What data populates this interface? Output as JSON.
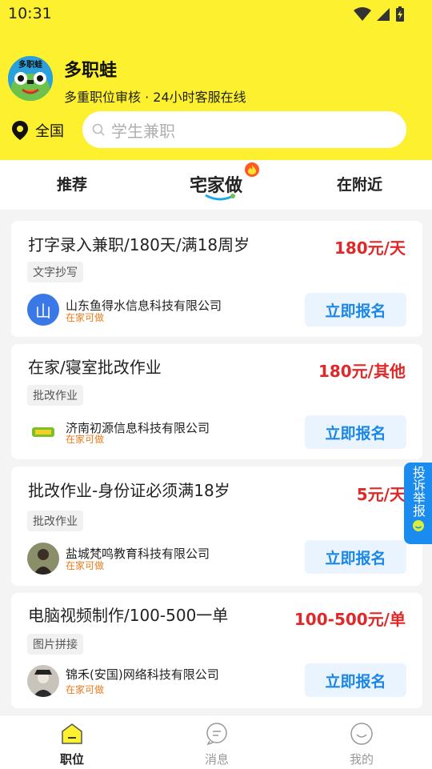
{
  "status": {
    "time": "10:31"
  },
  "header": {
    "logo_text": "多职蛙",
    "app_name": "多职蛙",
    "subtitle": "多重职位审核 · 24小时客服在线",
    "location": "全国",
    "search_placeholder": "学生兼职"
  },
  "tabs": [
    {
      "label": "推荐"
    },
    {
      "label": "宅家做"
    },
    {
      "label": "在附近"
    }
  ],
  "jobs": [
    {
      "title": "打字录入兼职/180天/满18周岁",
      "price": "180元/天",
      "tag": "文字抄写",
      "company": "山东鱼得水信息科技有限公司",
      "location": "在家可做",
      "avatar_text": "山",
      "apply": "立即报名"
    },
    {
      "title": "在家/寝室批改作业",
      "price": "180元/其他",
      "tag": "批改作业",
      "company": "济南初源信息科技有限公司",
      "location": "在家可做",
      "avatar_text": "",
      "apply": "立即报名"
    },
    {
      "title": "批改作业-身份证必须满18岁",
      "price": "5元/天",
      "tag": "批改作业",
      "company": "盐城梵鸣教育科技有限公司",
      "location": "在家可做",
      "avatar_text": "",
      "apply": "立即报名"
    },
    {
      "title": "电脑视频制作/100-500一单",
      "price": "100-500元/单",
      "tag": "图片拼接",
      "company": "锦禾(安国)网络科技有限公司",
      "location": "在家可做",
      "avatar_text": "",
      "apply": "立即报名"
    }
  ],
  "report": {
    "label": "投诉举报"
  },
  "nav": [
    {
      "label": "职位"
    },
    {
      "label": "消息"
    },
    {
      "label": "我的"
    }
  ],
  "colors": {
    "brand": "#fdf02e",
    "price": "#e02828",
    "accent": "#1a86e6",
    "tag_home": "#ee7a1a"
  }
}
